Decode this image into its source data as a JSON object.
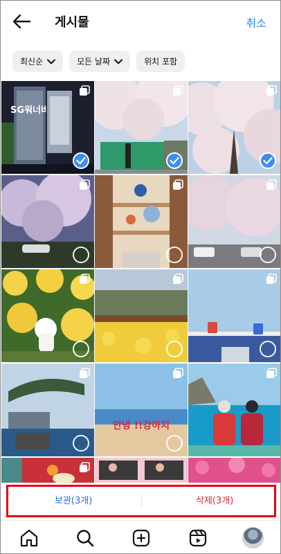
{
  "header": {
    "title": "게시물",
    "cancel_label": "취소"
  },
  "filters": [
    {
      "label": "최신순",
      "dropdown": true
    },
    {
      "label": "모든 날짜",
      "dropdown": true
    },
    {
      "label": "위치 포함",
      "dropdown": false
    }
  ],
  "grid": {
    "tiles": [
      {
        "theme": "concert-night",
        "poster_text": "SG워너비",
        "selected": true
      },
      {
        "theme": "cherry-green-fence",
        "selected": true
      },
      {
        "theme": "cherry-sky",
        "selected": true
      },
      {
        "theme": "cherry-night-stage",
        "selected": false
      },
      {
        "theme": "library-atrium",
        "selected": false
      },
      {
        "theme": "cherry-street",
        "selected": false
      },
      {
        "theme": "daffodil-dog",
        "selected": false
      },
      {
        "theme": "daffodil-village",
        "selected": false
      },
      {
        "theme": "sky-monorail",
        "selected": false
      },
      {
        "theme": "pine-temple-sea",
        "selected": false
      },
      {
        "theme": "beach-sign",
        "sign_text": "안녕 !!강아지",
        "selected": false
      },
      {
        "theme": "couple-sea",
        "selected": false
      },
      {
        "theme": "food-red",
        "selected": false
      },
      {
        "theme": "photo-booth",
        "selected": false
      },
      {
        "theme": "azalea",
        "selected": false
      }
    ],
    "selection_color": "#3e8ef0"
  },
  "actions": {
    "archive_label": "보관(3개)",
    "delete_label": "삭제(3개)",
    "highlight_color": "#e60012"
  },
  "nav": {
    "items": [
      "home-icon",
      "search-icon",
      "create-icon",
      "reels-icon",
      "profile-avatar"
    ]
  },
  "colors": {
    "accent": "#1a8cff",
    "delete": "#e0243a"
  }
}
